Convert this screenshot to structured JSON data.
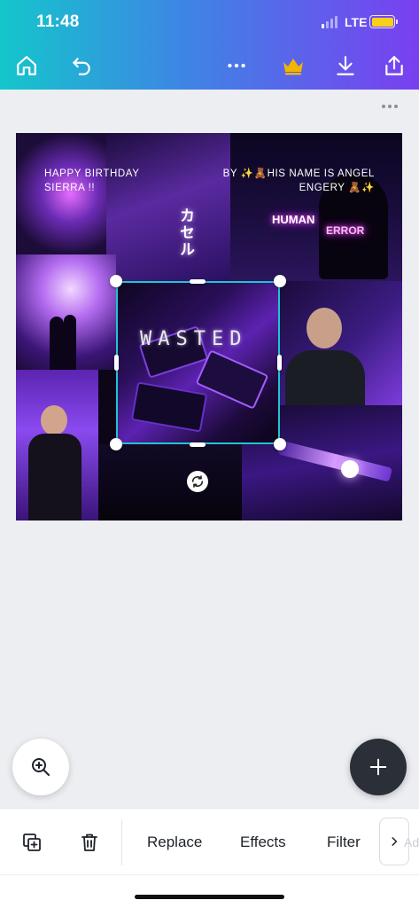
{
  "status_bar": {
    "time": "11:48",
    "network": "LTE",
    "signal_bars_active": 1,
    "signal_bars_total": 4,
    "battery_color": "#f7d01b"
  },
  "toolbar": {
    "icons": [
      "home-icon",
      "undo-icon",
      "more-icon",
      "crown-icon",
      "download-icon",
      "share-icon"
    ],
    "crown_color": "#f4b400"
  },
  "design": {
    "caption_left": "HAPPY BIRTHDAY\nSIERRA !!",
    "caption_right": "BY ✨🧸HIS NAME IS ANGEL\nENGERY 🧸✨",
    "neon_sign_1": "HUMAN",
    "neon_sign_2": "ERROR",
    "vertical_sign": "カセル",
    "wasted_text": "WASTED",
    "selection_color": "#21c4d3"
  },
  "bottom_bar": {
    "replace_label": "Replace",
    "effects_label": "Effects",
    "filter_label": "Filter",
    "next_ghost_label": "Ad"
  }
}
